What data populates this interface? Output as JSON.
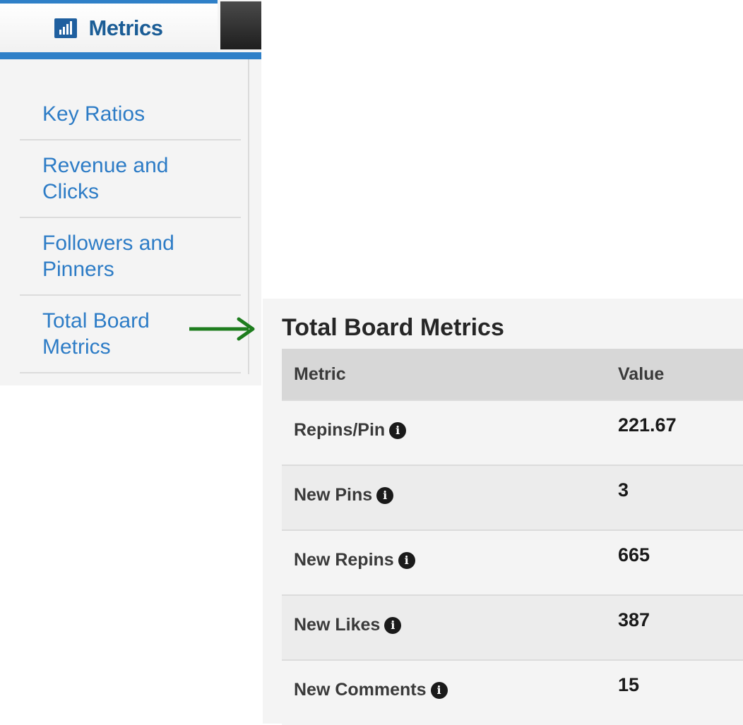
{
  "sidebar": {
    "tab_label": "Metrics",
    "tab_icon": "bar-chart-icon",
    "items": [
      {
        "line1": "Key Ratios",
        "line2": ""
      },
      {
        "line1": "Revenue and",
        "line2": "Clicks"
      },
      {
        "line1": "Followers and",
        "line2": "Pinners"
      },
      {
        "line1": "Total Board",
        "line2": "Metrics"
      }
    ]
  },
  "annotation": {
    "arrow_color": "#1e7d1e",
    "arrow_icon": "arrow-right-icon"
  },
  "panel": {
    "title": "Total Board Metrics",
    "columns": {
      "metric": "Metric",
      "value": "Value"
    },
    "rows": [
      {
        "metric": "Repins/Pin",
        "value": "221.67"
      },
      {
        "metric": "New Pins",
        "value": "3"
      },
      {
        "metric": "New Repins",
        "value": "665"
      },
      {
        "metric": "New Likes",
        "value": "387"
      },
      {
        "metric": "New Comments",
        "value": "15"
      }
    ],
    "info_icon_glyph": "i"
  },
  "colors": {
    "accent": "#2f80c8",
    "link": "#2d7cc6",
    "tab_label": "#1b5d96"
  }
}
